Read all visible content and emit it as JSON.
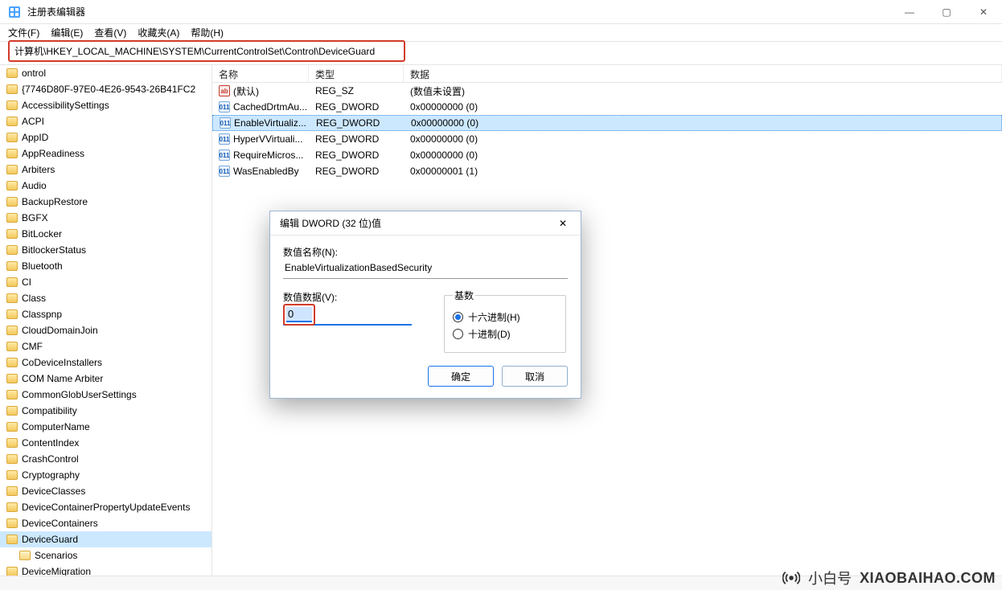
{
  "window": {
    "title": "注册表编辑器",
    "min": "—",
    "max": "▢",
    "close": "✕"
  },
  "menu": {
    "file": "文件(F)",
    "edit": "编辑(E)",
    "view": "查看(V)",
    "fav": "收藏夹(A)",
    "help": "帮助(H)"
  },
  "address": "计算机\\HKEY_LOCAL_MACHINE\\SYSTEM\\CurrentControlSet\\Control\\DeviceGuard",
  "columns": {
    "name": "名称",
    "type": "类型",
    "data": "数据"
  },
  "tree": [
    "ontrol",
    "{7746D80F-97E0-4E26-9543-26B41FC2",
    "AccessibilitySettings",
    "ACPI",
    "AppID",
    "AppReadiness",
    "Arbiters",
    "Audio",
    "BackupRestore",
    "BGFX",
    "BitLocker",
    "BitlockerStatus",
    "Bluetooth",
    "CI",
    "Class",
    "Classpnp",
    "CloudDomainJoin",
    "CMF",
    "CoDeviceInstallers",
    "COM Name Arbiter",
    "CommonGlobUserSettings",
    "Compatibility",
    "ComputerName",
    "ContentIndex",
    "CrashControl",
    "Cryptography",
    "DeviceClasses",
    "DeviceContainerPropertyUpdateEvents",
    "DeviceContainers",
    "DeviceGuard",
    "Scenarios",
    "DeviceMigration"
  ],
  "tree_selected_index": 29,
  "tree_child_indexes": [
    30
  ],
  "values": [
    {
      "icon": "ab",
      "name": "(默认)",
      "type": "REG_SZ",
      "data": "(数值未设置)"
    },
    {
      "icon": "bin",
      "name": "CachedDrtmAu...",
      "type": "REG_DWORD",
      "data": "0x00000000 (0)"
    },
    {
      "icon": "bin",
      "name": "EnableVirtualiz...",
      "type": "REG_DWORD",
      "data": "0x00000000 (0)",
      "selected": true
    },
    {
      "icon": "bin",
      "name": "HyperVVirtuali...",
      "type": "REG_DWORD",
      "data": "0x00000000 (0)"
    },
    {
      "icon": "bin",
      "name": "RequireMicros...",
      "type": "REG_DWORD",
      "data": "0x00000000 (0)"
    },
    {
      "icon": "bin",
      "name": "WasEnabledBy",
      "type": "REG_DWORD",
      "data": "0x00000001 (1)"
    }
  ],
  "dialog": {
    "title": "编辑 DWORD (32 位)值",
    "name_label": "数值名称(N):",
    "name_value": "EnableVirtualizationBasedSecurity",
    "data_label": "数值数据(V):",
    "data_value": "0",
    "base_label": "基数",
    "hex": "十六进制(H)",
    "dec": "十进制(D)",
    "base_selected": "hex",
    "ok": "确定",
    "cancel": "取消"
  },
  "brand": {
    "cn": "小白号",
    "en": "XIAOBAIHAO.COM"
  }
}
